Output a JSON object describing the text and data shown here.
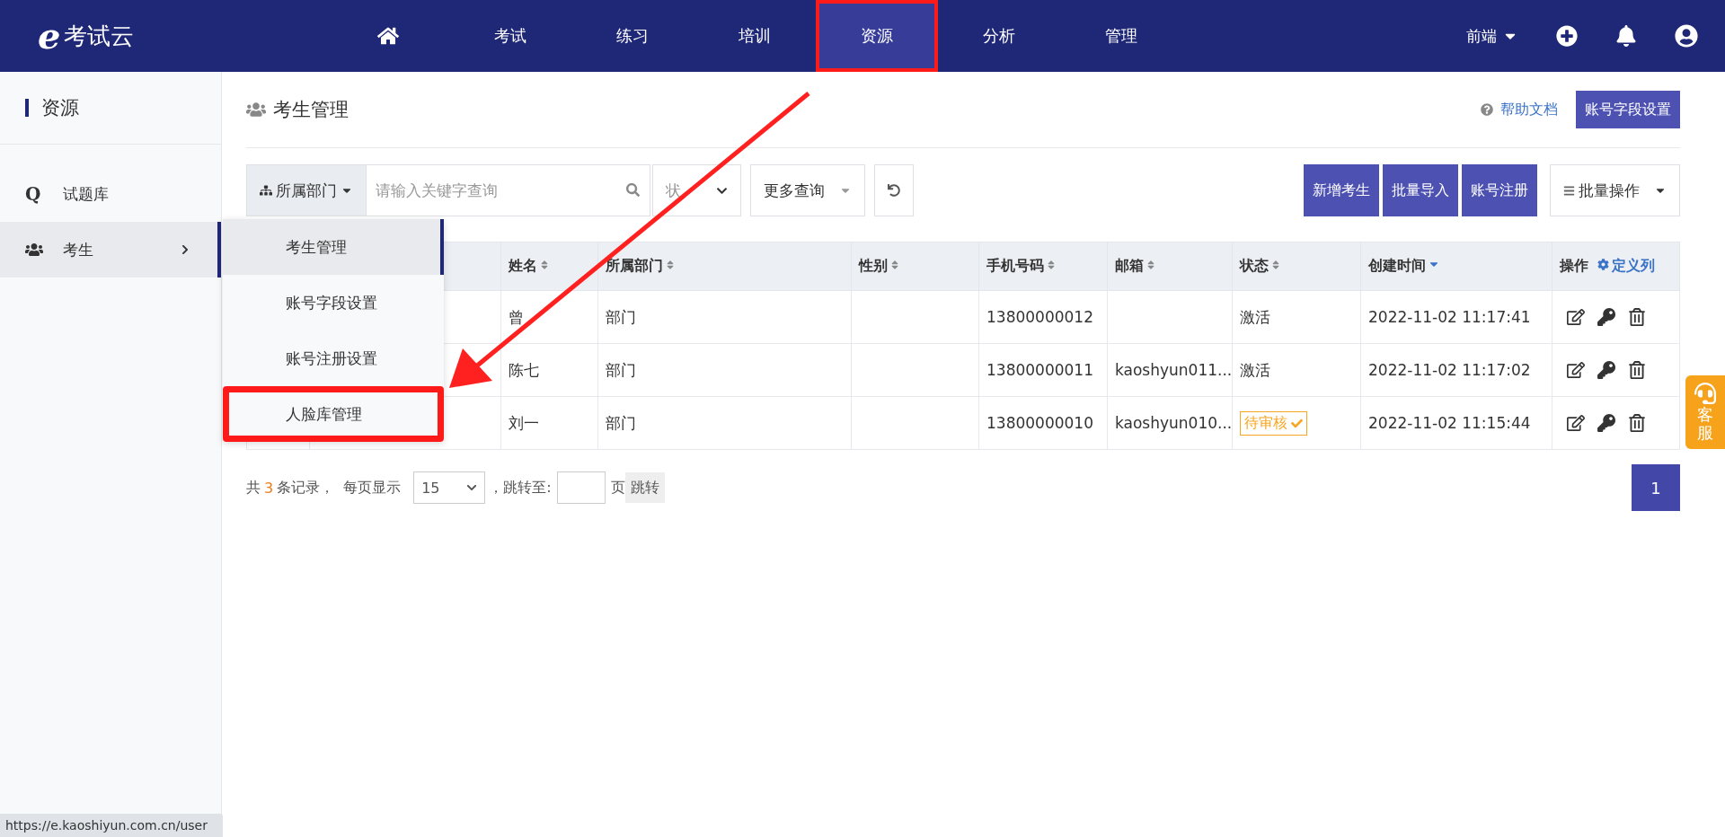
{
  "nav": {
    "logo_mark": "e",
    "logo_text": "考试云",
    "items": [
      {
        "kind": "home",
        "selected": false,
        "highlighted": false
      },
      {
        "kind": "text",
        "label": "考试",
        "selected": false,
        "highlighted": false
      },
      {
        "kind": "text",
        "label": "练习",
        "selected": false,
        "highlighted": false
      },
      {
        "kind": "text",
        "label": "培训",
        "selected": false,
        "highlighted": false
      },
      {
        "kind": "text",
        "label": "资源",
        "selected": true,
        "highlighted": true
      },
      {
        "kind": "text",
        "label": "分析",
        "selected": false,
        "highlighted": false
      },
      {
        "kind": "text",
        "label": "管理",
        "selected": false,
        "highlighted": false
      }
    ],
    "user_menu": "前端"
  },
  "sidebar": {
    "title": "资源",
    "items": [
      {
        "kind": "letter",
        "icon_text": "Q",
        "label": "试题库",
        "selected": false,
        "expanded": false
      },
      {
        "kind": "group",
        "label": "考生",
        "selected": true,
        "expanded": true
      }
    ]
  },
  "submenu": [
    {
      "label": "考生管理",
      "selected": true,
      "highlighted": false
    },
    {
      "label": "账号字段设置",
      "selected": false,
      "highlighted": false
    },
    {
      "label": "账号注册设置",
      "selected": false,
      "highlighted": false
    },
    {
      "label": "人脸库管理",
      "selected": false,
      "highlighted": true
    }
  ],
  "page": {
    "title": "考生管理",
    "help": "帮助文档",
    "settings_button": "账号字段设置"
  },
  "toolbar": {
    "department": "所属部门",
    "search_placeholder": "请输入关键字查询",
    "status": "状",
    "more": "更多查询",
    "buttons": [
      "新增考生",
      "批量导入",
      "账号注册"
    ],
    "batch": "批量操作"
  },
  "table": {
    "columns": [
      {
        "label": "姓名",
        "sortable": true,
        "sorted": false
      },
      {
        "label": "所属部门",
        "sortable": true,
        "sorted": false
      },
      {
        "label": "性别",
        "sortable": true,
        "sorted": false
      },
      {
        "label": "手机号码",
        "sortable": true,
        "sorted": false
      },
      {
        "label": "邮箱",
        "sortable": true,
        "sorted": false
      },
      {
        "label": "状态",
        "sortable": true,
        "sorted": false
      },
      {
        "label": "创建时间",
        "sortable": true,
        "sorted": true
      },
      {
        "label": "操作",
        "sortable": false,
        "sorted": false
      }
    ],
    "columns_link": "定义列",
    "rows": [
      {
        "name": "曾",
        "department": "部门",
        "phone": "13800000012",
        "email": "",
        "status": "激活",
        "pending": false,
        "created": "2022-11-02 11:17:41"
      },
      {
        "name": "陈七",
        "department": "部门",
        "phone": "13800000011",
        "email": "kaoshyun011...",
        "status": "激活",
        "pending": false,
        "created": "2022-11-02 11:17:02"
      },
      {
        "name": "刘一",
        "department": "部门",
        "phone": "13800000010",
        "email": "kaoshyun010...",
        "status": "待审核",
        "pending": true,
        "created": "2022-11-02 11:15:44"
      }
    ]
  },
  "pagination": {
    "prefix": "共",
    "total": "3",
    "suffix": "条记录，",
    "per_page_label": "每页显示",
    "per_page": "15",
    "jump_label": "，跳转至:",
    "page_unit": "页",
    "jump_button": "跳转",
    "pages": [
      {
        "label": "1",
        "selected": true
      }
    ]
  },
  "service": "客服",
  "status_url": "https://e.kaoshiyun.com.cn/user"
}
